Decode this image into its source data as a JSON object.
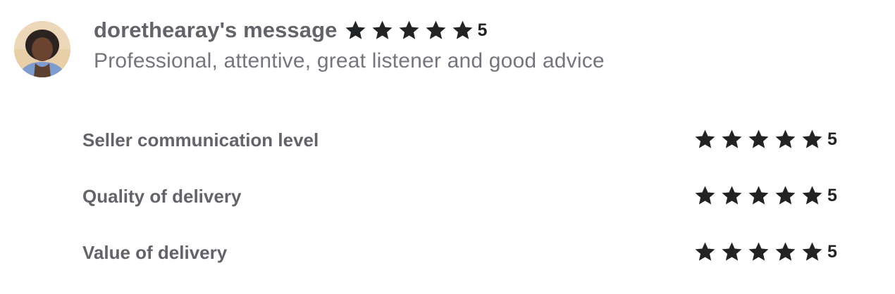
{
  "review": {
    "username": "dorethearay's message",
    "rating": "5",
    "stars_filled": 5,
    "stars_total": 5,
    "comment": "Professional, attentive, great listener and good advice"
  },
  "breakdown": [
    {
      "label": "Seller communication level",
      "rating": "5"
    },
    {
      "label": "Quality of delivery",
      "rating": "5"
    },
    {
      "label": "Value of delivery",
      "rating": "5"
    }
  ],
  "colors": {
    "star": "#222325",
    "username": "#62646a",
    "comment": "#74767e"
  },
  "icons": {
    "avatar": "user-avatar",
    "star": "star-icon"
  }
}
